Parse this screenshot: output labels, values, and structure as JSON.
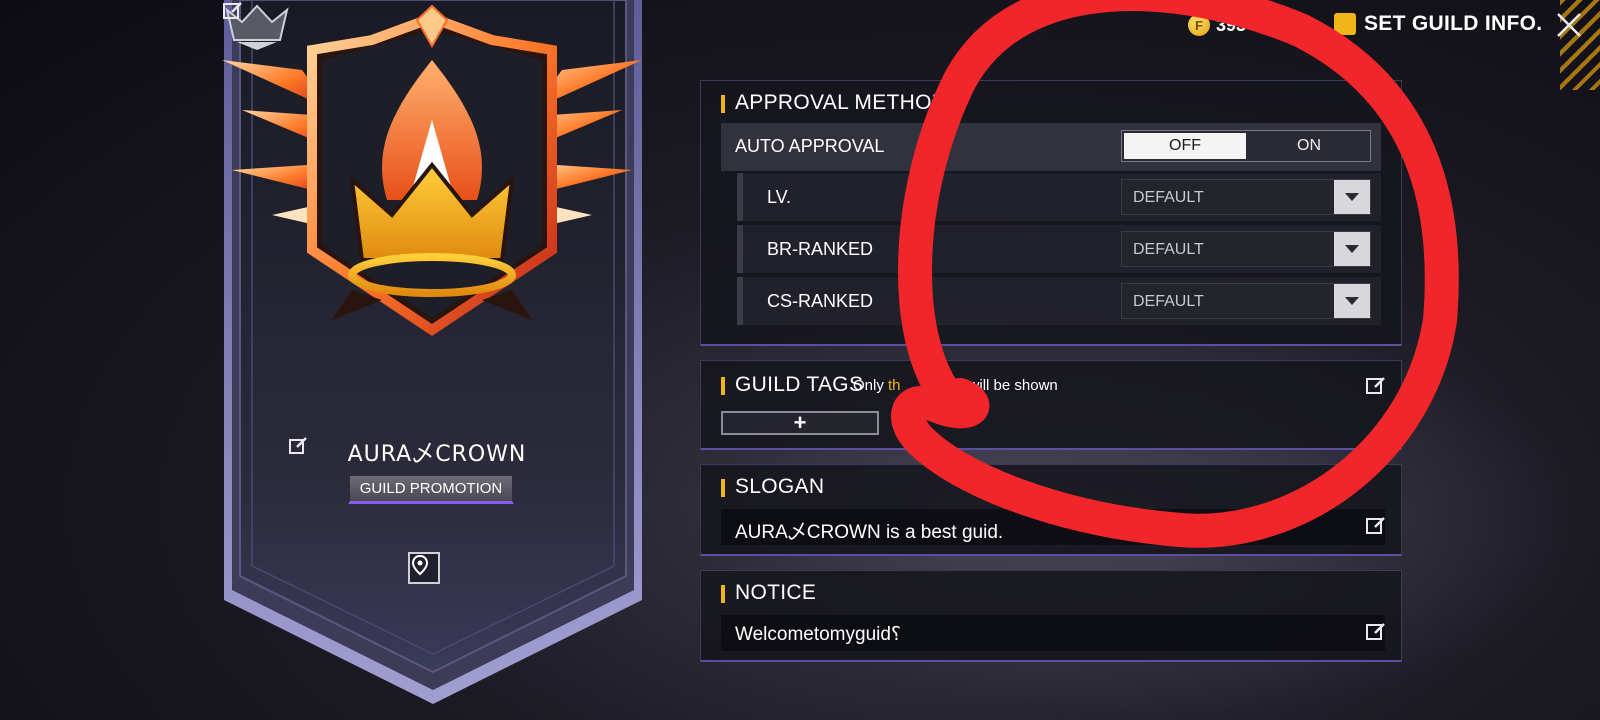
{
  "topbar": {
    "coins_value": "393",
    "coin_symbol": "F",
    "set_guild_info_label": "SET GUILD INFO.",
    "close_icon": "close-icon"
  },
  "banner": {
    "guild_name": "AURA乄CROWN",
    "promotion_label": "GUILD PROMOTION",
    "emblem_icon": "flame-crown-emblem",
    "location_icon": "location-pin-icon"
  },
  "approval": {
    "title": "APPROVAL METHOD",
    "auto_label": "AUTO APPROVAL",
    "toggle_off": "OFF",
    "toggle_on": "ON",
    "selected": "OFF",
    "rows": [
      {
        "label": "LV.",
        "value": "DEFAULT"
      },
      {
        "label": "BR-RANKED",
        "value": "DEFAULT"
      },
      {
        "label": "CS-RANKED",
        "value": "DEFAULT"
      }
    ]
  },
  "tags": {
    "title": "GUILD TAGS",
    "hint_prefix": "Only ",
    "hint_highlight": "th",
    "hint_suffix": "will be shown",
    "add_label": "+"
  },
  "slogan": {
    "title": "SLOGAN",
    "text": "AURA乄CROWN is a best guid."
  },
  "notice": {
    "title": "NOTICE",
    "text": "Welcometomyguid⸮"
  },
  "colors": {
    "accent": "#f2b41c",
    "scribble": "#f0262a",
    "panel_border": "#5a4fa0"
  }
}
